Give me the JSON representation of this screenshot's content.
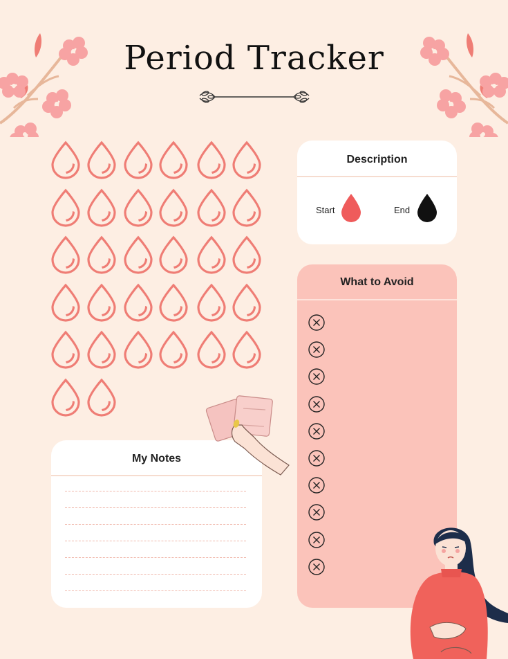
{
  "title": "Period Tracker",
  "tracker": {
    "days": 32,
    "per_row": 6,
    "drop_color": "#ef7d75"
  },
  "description": {
    "title": "Description",
    "start_label": "Start",
    "start_color": "#ef5b5b",
    "end_label": "End",
    "end_color": "#111111"
  },
  "avoid": {
    "title": "What to Avoid",
    "items": 10,
    "icon": "close-circle-icon"
  },
  "notes": {
    "title": "My Notes",
    "lines": 7
  },
  "colors": {
    "background": "#fdeee3",
    "accent": "#fbc3ba",
    "blossom": "#f7a3a3"
  }
}
